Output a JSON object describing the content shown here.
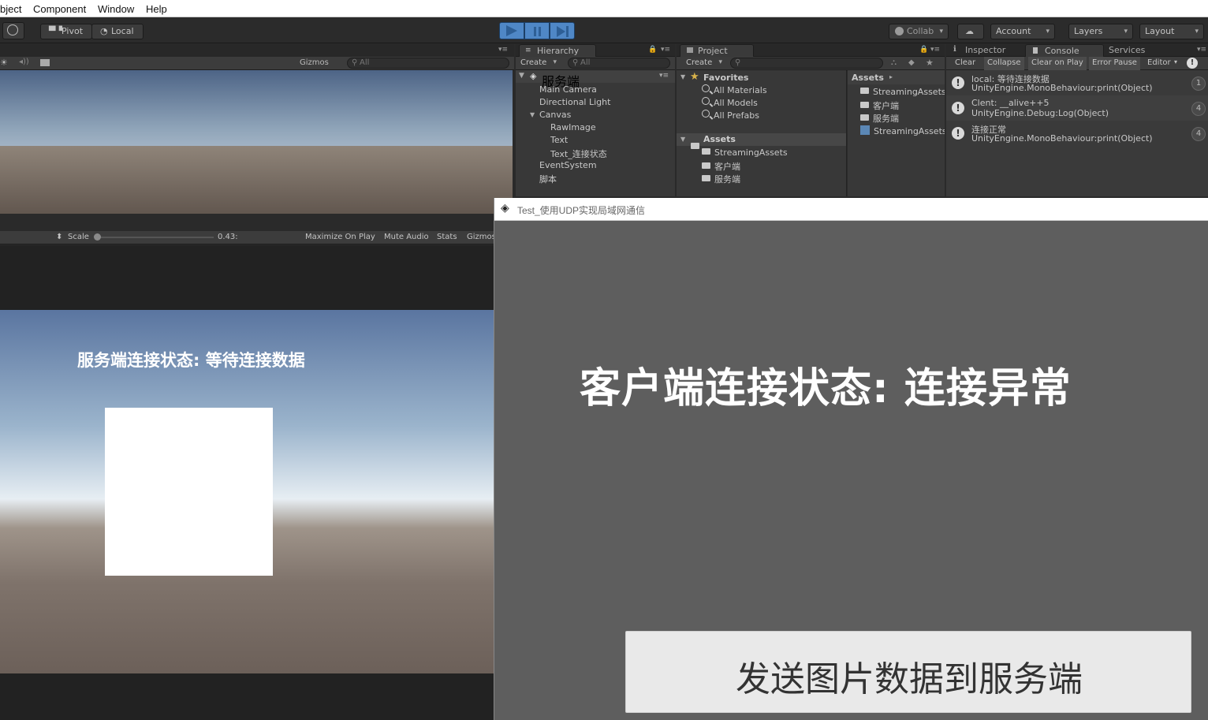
{
  "menubar": {
    "items": [
      "bject",
      "Component",
      "Window",
      "Help"
    ]
  },
  "toolbar": {
    "pivot": "Pivot",
    "local": "Local",
    "collab": "Collab",
    "account": "Account",
    "layers": "Layers",
    "layout": "Layout"
  },
  "scene_view": {
    "gizmos": "Gizmos",
    "search_placeholder": "All"
  },
  "hierarchy": {
    "tab": "Hierarchy",
    "create": "Create",
    "search_placeholder": "All",
    "scene_name": "服务端",
    "items": [
      {
        "label": "Main Camera"
      },
      {
        "label": "Directional Light"
      },
      {
        "label": "Canvas"
      },
      {
        "label": "RawImage"
      },
      {
        "label": "Text"
      },
      {
        "label": "Text_连接状态"
      },
      {
        "label": "EventSystem"
      },
      {
        "label": "脚本"
      }
    ]
  },
  "project": {
    "tab": "Project",
    "create": "Create",
    "favorites_label": "Favorites",
    "favorites": [
      "All Materials",
      "All Models",
      "All Prefabs"
    ],
    "assets_label": "Assets",
    "asset_folders": [
      "StreamingAssets",
      "客户端",
      "服务端"
    ],
    "breadcrumb": "Assets",
    "right_items": [
      "StreamingAssets",
      "客户端",
      "服务端",
      "StreamingAssets"
    ]
  },
  "console": {
    "tabs": [
      "Inspector",
      "Console",
      "Services"
    ],
    "buttons": [
      "Clear",
      "Collapse",
      "Clear on Play",
      "Error Pause",
      "Editor"
    ],
    "entries": [
      {
        "line1": "local:  等待连接数据",
        "line2": "UnityEngine.MonoBehaviour:print(Object)",
        "count": "1"
      },
      {
        "line1": "Clent:  __alive++5",
        "line2": "UnityEngine.Debug:Log(Object)",
        "count": "4"
      },
      {
        "line1": "连接正常",
        "line2": "UnityEngine.MonoBehaviour:print(Object)",
        "count": "4"
      }
    ]
  },
  "game_view": {
    "scale_label": "Scale",
    "scale_value": "0.43:",
    "maximize": "Maximize On Play",
    "mute": "Mute Audio",
    "stats": "Stats",
    "gizmos": "Gizmos",
    "status_text": "服务端连接状态:  等待连接数据"
  },
  "player_window": {
    "title": "Test_使用UDP实现局域网通信",
    "status_text": "客户端连接状态:  连接异常",
    "send_button": "发送图片数据到服务端"
  }
}
